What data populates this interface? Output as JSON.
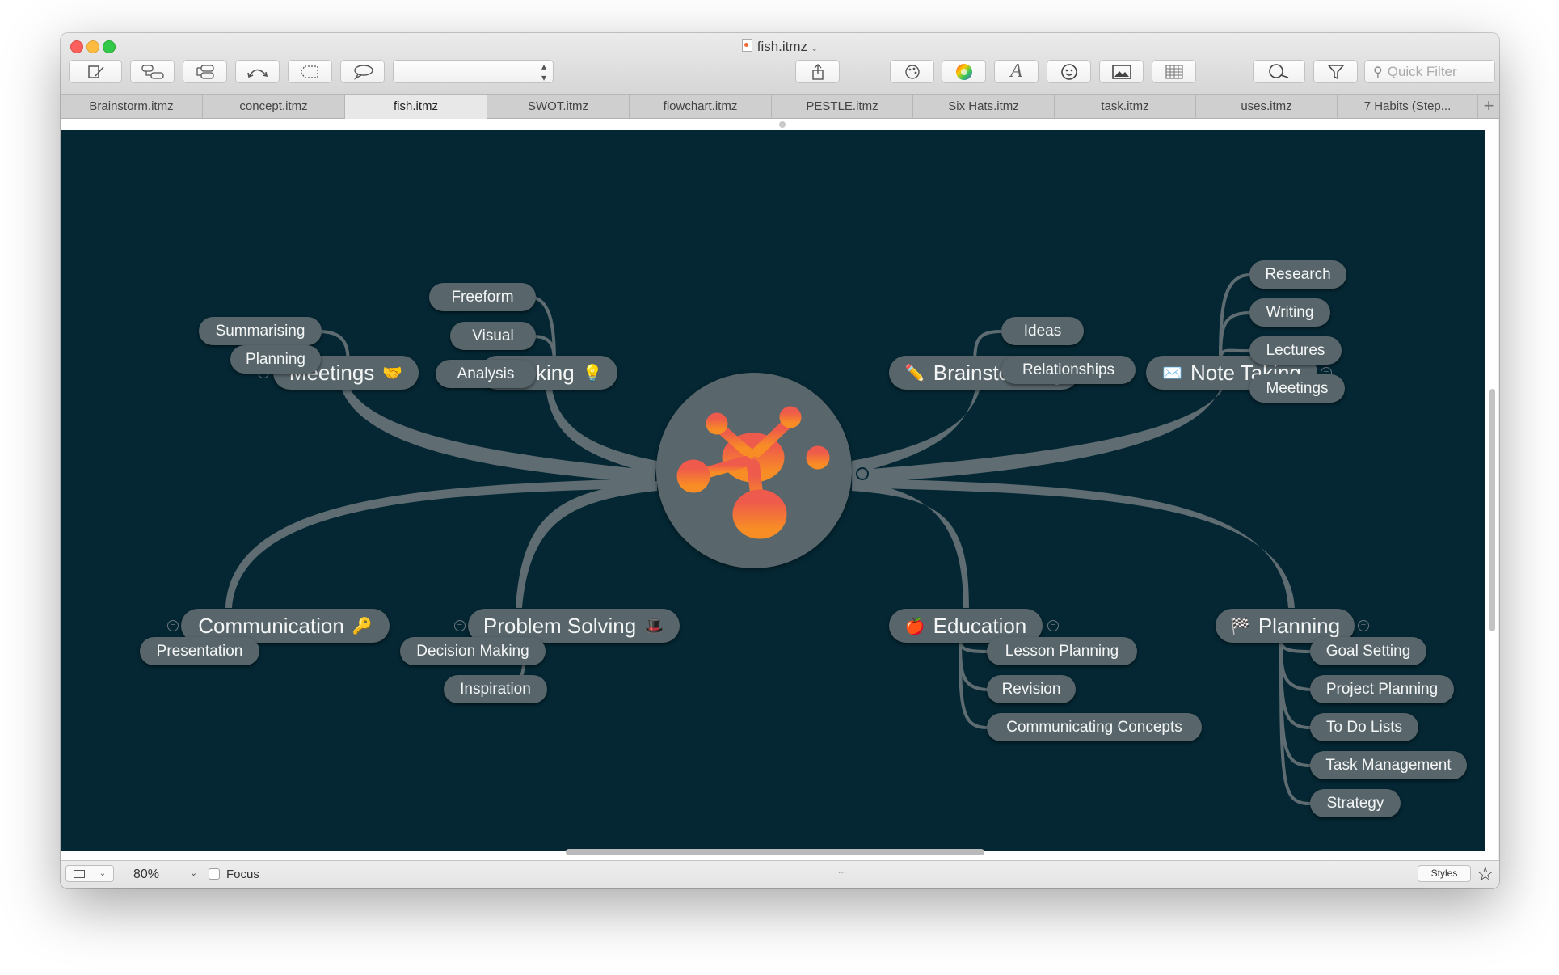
{
  "window": {
    "title": "fish.itmz"
  },
  "toolbar": {
    "quick_filter_placeholder": "Quick Filter",
    "style_select_value": ""
  },
  "tabs": [
    {
      "label": "Brainstorm.itmz",
      "active": false
    },
    {
      "label": "concept.itmz",
      "active": false
    },
    {
      "label": "fish.itmz",
      "active": true
    },
    {
      "label": "SWOT.itmz",
      "active": false
    },
    {
      "label": "flowchart.itmz",
      "active": false
    },
    {
      "label": "PESTLE.itmz",
      "active": false
    },
    {
      "label": "Six Hats.itmz",
      "active": false
    },
    {
      "label": "task.itmz",
      "active": false
    },
    {
      "label": "uses.itmz",
      "active": false
    },
    {
      "label": "7 Habits (Step...",
      "active": false
    }
  ],
  "colors": {
    "canvas_bg": "#042733",
    "node_bg": "#58666c",
    "connector": "#5f6d72",
    "logo_top": "#ee5a4b",
    "logo_bottom": "#f88d25"
  },
  "mindmap": {
    "central": {
      "icon": "imindmap-logo-icon"
    },
    "branches": {
      "meetings": {
        "label": "Meetings",
        "icon": "handshake-icon",
        "children": [
          "Summarising",
          "Planning"
        ]
      },
      "thinking": {
        "label": "Thinking",
        "icon": "lightbulb-icon",
        "children": [
          "Freeform",
          "Visual",
          "Analysis"
        ]
      },
      "brainstorming": {
        "label": "Brainstorming",
        "icon": "pencil-icon",
        "children": [
          "Ideas",
          "Relationships"
        ]
      },
      "note_taking": {
        "label": "Note Taking",
        "icon": "envelope-icon",
        "children": [
          "Research",
          "Writing",
          "Lectures",
          "Meetings"
        ]
      },
      "communication": {
        "label": "Communication",
        "icon": "key-icon",
        "children": [
          "Presentation"
        ]
      },
      "problem_solving": {
        "label": "Problem Solving",
        "icon": "hat-icon",
        "children": [
          "Decision Making",
          "Inspiration"
        ]
      },
      "education": {
        "label": "Education",
        "icon": "apple-icon",
        "children": [
          "Lesson Planning",
          "Revision",
          "Communicating Concepts"
        ]
      },
      "planning": {
        "label": "Planning",
        "icon": "checkered-flag-icon",
        "children": [
          "Goal Setting",
          "Project Planning",
          "To Do Lists",
          "Task Management",
          "Strategy"
        ]
      }
    }
  },
  "statusbar": {
    "zoom": "80%",
    "focus_label": "Focus",
    "focus_checked": false,
    "dots": "...",
    "styles_label": "Styles"
  }
}
